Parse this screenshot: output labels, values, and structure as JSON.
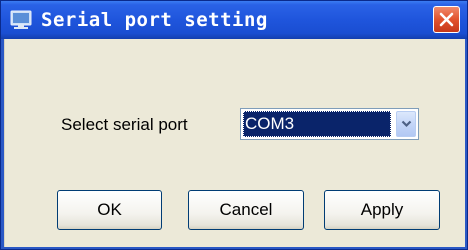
{
  "window": {
    "title": "Serial port setting",
    "title_icon": "monitor-icon",
    "close_icon": "close-icon"
  },
  "form": {
    "port_label": "Select serial port",
    "port_value": "COM3",
    "dropdown_icon": "chevron-down-icon"
  },
  "buttons": {
    "ok": "OK",
    "cancel": "Cancel",
    "apply": "Apply"
  },
  "colors": {
    "titlebar": "#1f55dc",
    "close_button": "#e2532d",
    "dialog_background": "#ece9d8",
    "selection": "#0a246a"
  }
}
